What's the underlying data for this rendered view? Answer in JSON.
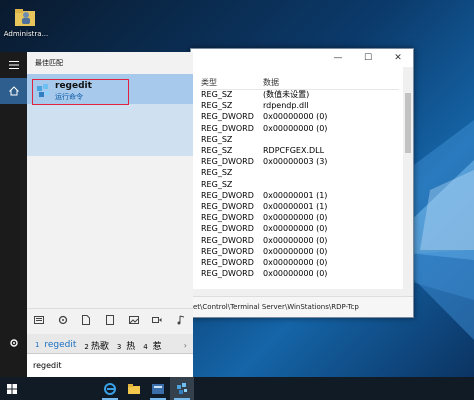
{
  "desktop": {
    "icon_label": "Administra..."
  },
  "regedit": {
    "columns": [
      "类型",
      "数据"
    ],
    "rows": [
      {
        "type": "REG_SZ",
        "data": "(数值未设置)"
      },
      {
        "type": "REG_SZ",
        "data": "rdpendp.dll"
      },
      {
        "type": "REG_DWORD",
        "data": "0x00000000 (0)"
      },
      {
        "type": "REG_DWORD",
        "data": "0x00000000 (0)"
      },
      {
        "type": "REG_SZ",
        "data": ""
      },
      {
        "type": "REG_SZ",
        "data": "RDPCFGEX.DLL"
      },
      {
        "type": "REG_DWORD",
        "data": "0x00000003 (3)"
      },
      {
        "type": "REG_SZ",
        "data": ""
      },
      {
        "type": "REG_SZ",
        "data": ""
      },
      {
        "type": "REG_DWORD",
        "data": "0x00000001 (1)"
      },
      {
        "type": "REG_DWORD",
        "data": "0x00000001 (1)"
      },
      {
        "type": "REG_DWORD",
        "data": "0x00000000 (0)"
      },
      {
        "type": "REG_DWORD",
        "data": "0x00000000 (0)"
      },
      {
        "type": "REG_DWORD",
        "data": "0x00000000 (0)"
      },
      {
        "type": "REG_DWORD",
        "data": "0x00000000 (0)"
      },
      {
        "type": "REG_DWORD",
        "data": "0x00000000 (0)"
      },
      {
        "type": "REG_DWORD",
        "data": "0x00000000 (0)"
      }
    ],
    "status_path": "et\\Control\\Terminal Server\\WinStations\\RDP-Tcp"
  },
  "start": {
    "best_match_title": "最佳匹配",
    "best_match": {
      "name": "regedit",
      "subtitle": "运行命令"
    },
    "filters": [
      "documents-icon",
      "settings-icon",
      "file-icon",
      "folder-icon",
      "photos-icon",
      "video-icon",
      "music-icon"
    ],
    "ime": {
      "candidates": [
        {
          "num": "1",
          "text": "regedit"
        },
        {
          "num": "2",
          "text": "热歌"
        },
        {
          "num": "3",
          "text": "热"
        },
        {
          "num": "4",
          "text": "惹"
        }
      ]
    },
    "search_value": "regedit"
  },
  "colors": {
    "accent": "#2e5e8e",
    "highlight": "#a7c9ec",
    "selection_border": "#e0233f",
    "taskbar": "#101b26"
  }
}
